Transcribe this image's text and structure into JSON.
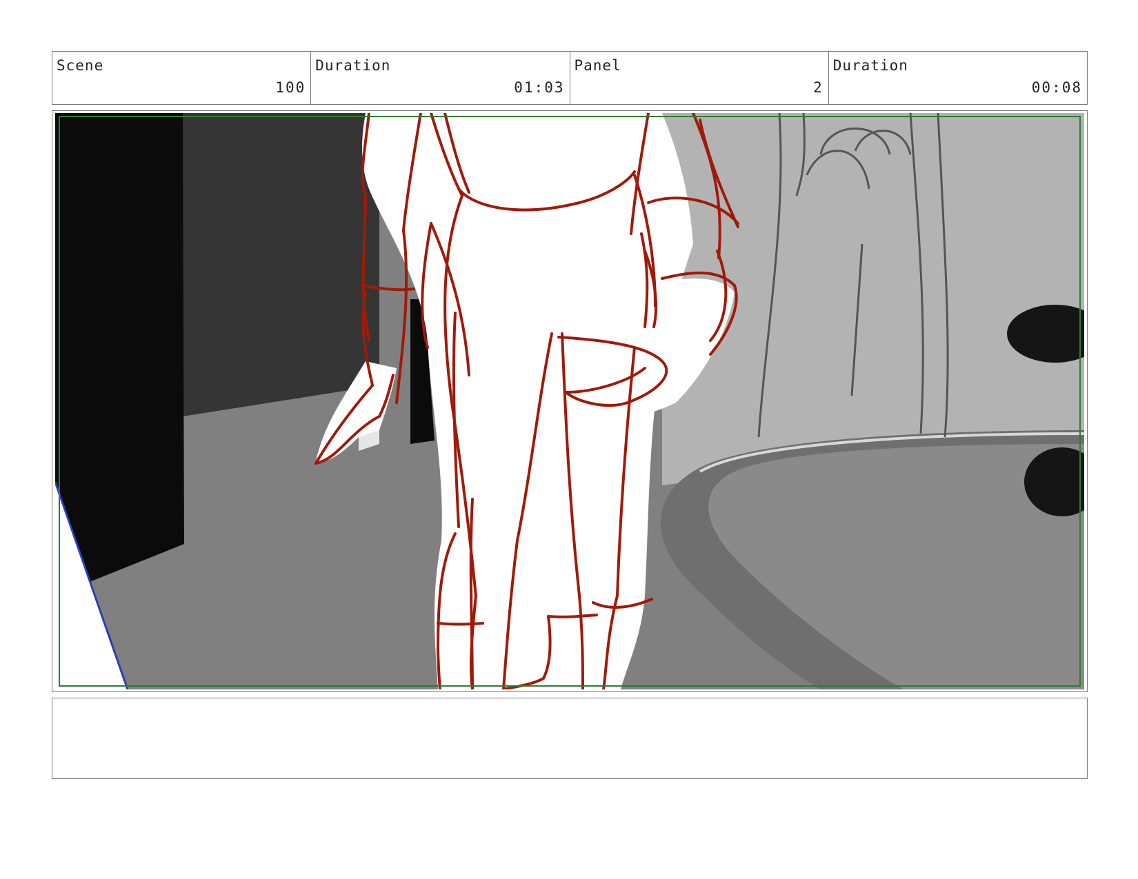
{
  "header": {
    "scene_label": "Scene",
    "scene_value": "100",
    "scene_duration_label": "Duration",
    "scene_duration_value": "01:03",
    "panel_label": "Panel",
    "panel_value": "2",
    "panel_duration_label": "Duration",
    "panel_duration_value": "00:08"
  },
  "notes": {
    "text": ""
  },
  "colors": {
    "sketch_line": "#a01a0a",
    "safe_frame": "#2e7d32",
    "camera_edge": "#2a3fb0"
  }
}
